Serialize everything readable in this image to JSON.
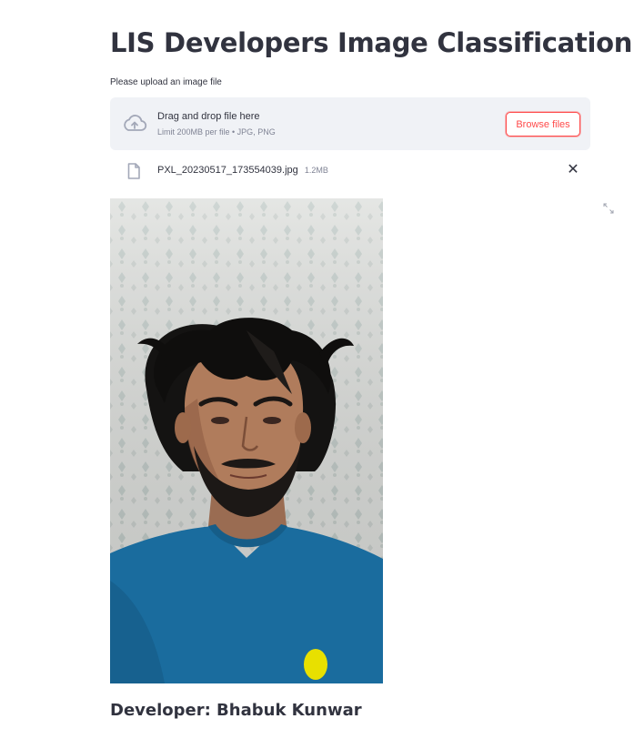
{
  "header": {
    "title": "LIS Developers Image Classification"
  },
  "uploader": {
    "label": "Please upload an image file",
    "dropzone_title": "Drag and drop file here",
    "dropzone_limit": "Limit 200MB per file • JPG, PNG",
    "browse_label": "Browse files",
    "icon": "cloud-upload-icon"
  },
  "uploaded_file": {
    "name": "PXL_20230517_173554039.jpg",
    "size": "1.2MB",
    "icon": "file-icon",
    "remove_label": "✕"
  },
  "image": {
    "subject": "uploaded-photo"
  },
  "footer": {
    "developer": "Developer: Bhabuk Kunwar"
  },
  "colors": {
    "accent": "#ff4b4b",
    "text": "#31333f",
    "muted": "#808495",
    "dropzone_bg": "#f0f2f6",
    "shirt": "#1a6c9e"
  }
}
